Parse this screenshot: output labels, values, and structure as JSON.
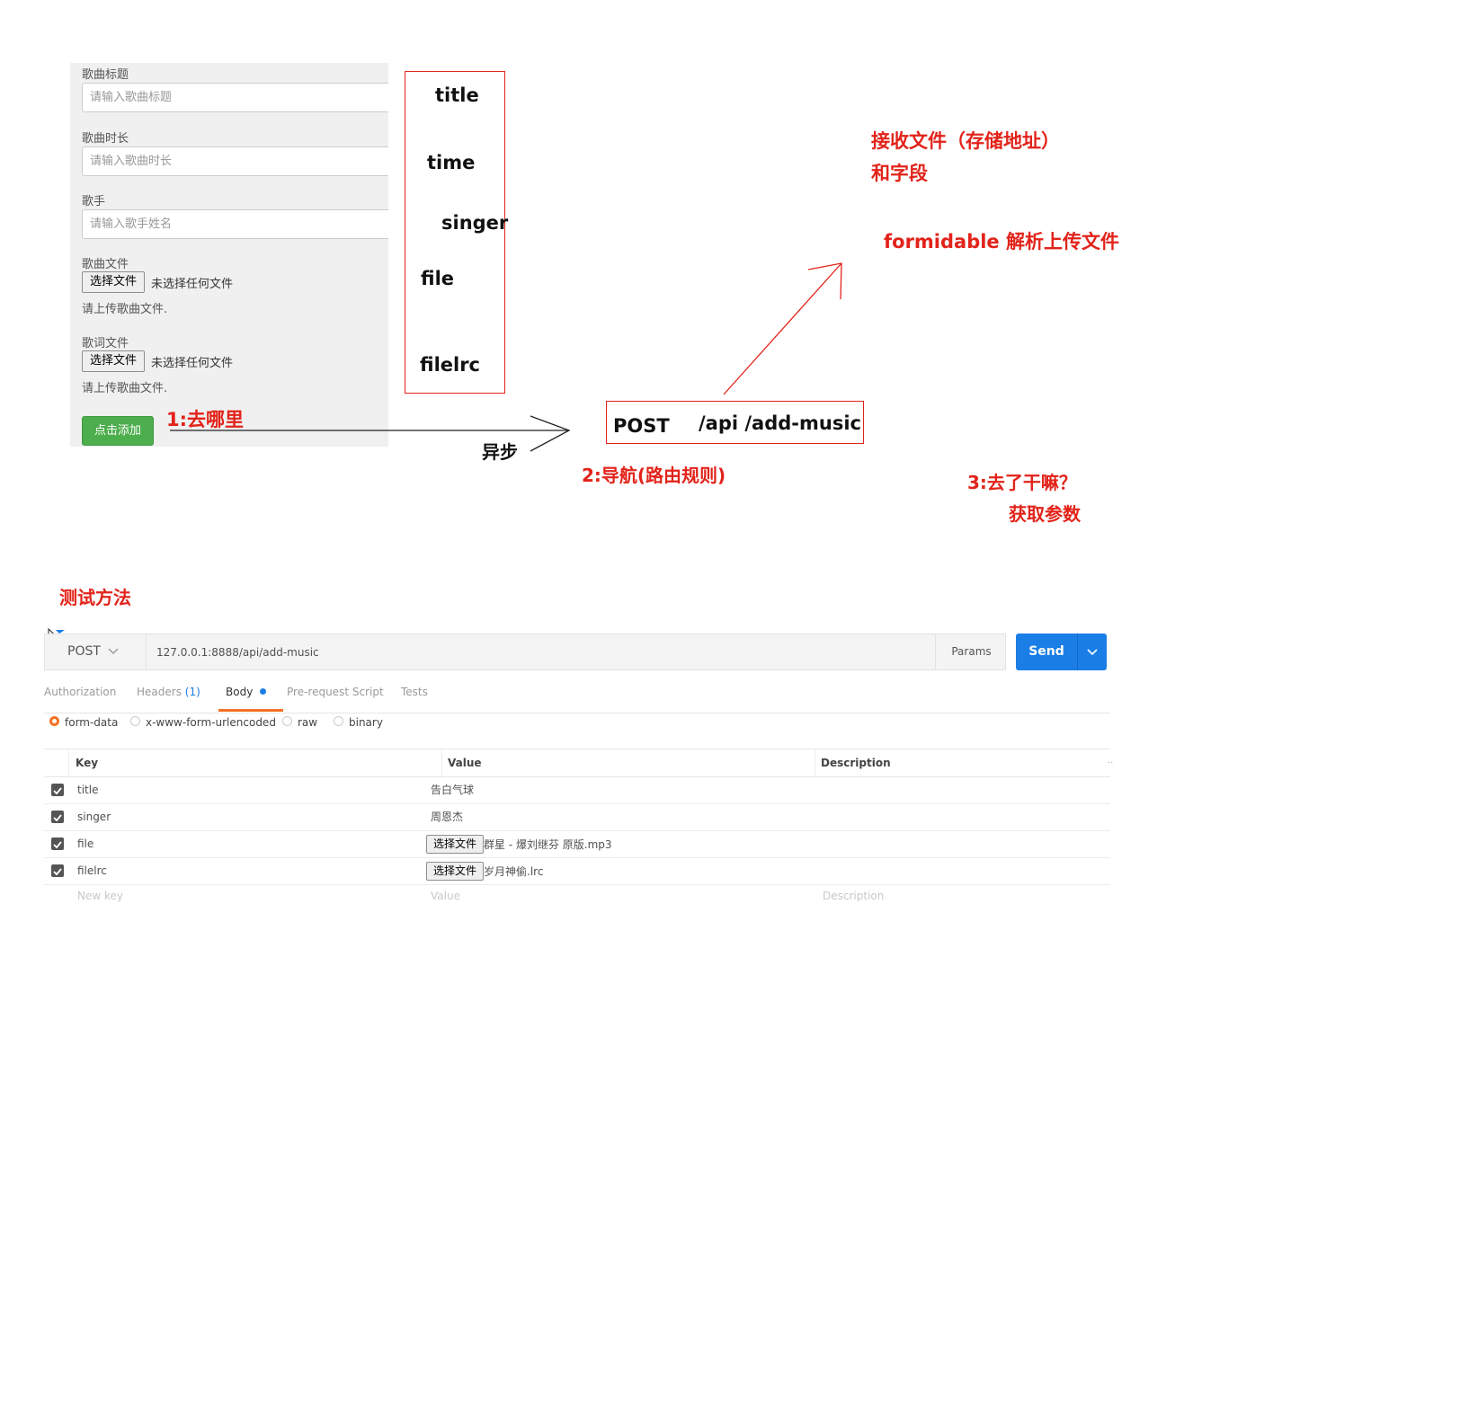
{
  "form": {
    "title_label": "歌曲标题",
    "title_placeholder": "请输入歌曲标题",
    "time_label": "歌曲时长",
    "time_placeholder": "请输入歌曲时长",
    "singer_label": "歌手",
    "singer_placeholder": "请输入歌手姓名",
    "file_label": "歌曲文件",
    "file_button": "选择文件",
    "file_status": "未选择任何文件",
    "file_help": "请上传歌曲文件.",
    "lrc_label": "歌词文件",
    "lrc_button": "选择文件",
    "lrc_status": "未选择任何文件",
    "lrc_help": "请上传歌曲文件.",
    "add_button": "点击添加"
  },
  "annotations": {
    "field_names": [
      "title",
      "time",
      "singer",
      "file",
      "filelrc"
    ],
    "step1": "1:去哪里",
    "async": "异步",
    "route_method": "POST",
    "route_path": "/api /add-music",
    "step2": "2:导航(路由规则)",
    "receive_line1": "接收文件（存储地址）",
    "receive_line2": "和字段",
    "formidable": "formidable 解析上传文件",
    "step3_line1": "3:去了干嘛？",
    "step3_line2": "获取参数",
    "test_method": "测试方法"
  },
  "postman": {
    "method": "POST",
    "url": "127.0.0.1:8888/api/add-music",
    "params_button": "Params",
    "send_button": "Send",
    "tabs": [
      {
        "label": "Authorization"
      },
      {
        "label": "Headers",
        "count": "(1)"
      },
      {
        "label": "Body"
      },
      {
        "label": "Pre-request Script"
      },
      {
        "label": "Tests"
      }
    ],
    "body_types": [
      "form-data",
      "x-www-form-urlencoded",
      "raw",
      "binary"
    ],
    "selected_body_type": "form-data",
    "columns": [
      "Key",
      "Value",
      "Description"
    ],
    "rows": [
      {
        "key": "title",
        "value": "告白气球",
        "checked": true
      },
      {
        "key": "singer",
        "value": "周恩杰",
        "checked": true
      },
      {
        "key": "file",
        "button": "选择文件",
        "value": "群星 - 爆刘继芬 原版.mp3",
        "checked": true
      },
      {
        "key": "filelrc",
        "button": "选择文件",
        "value": "岁月神偷.lrc",
        "checked": true
      }
    ],
    "new_row": {
      "key": "New key",
      "value": "Value",
      "description": "Description"
    }
  },
  "colors": {
    "annotation_red": "#e2231a",
    "send_blue": "#1a7ee6",
    "add_green": "#4cae4c",
    "active_tab": "#f47023"
  }
}
